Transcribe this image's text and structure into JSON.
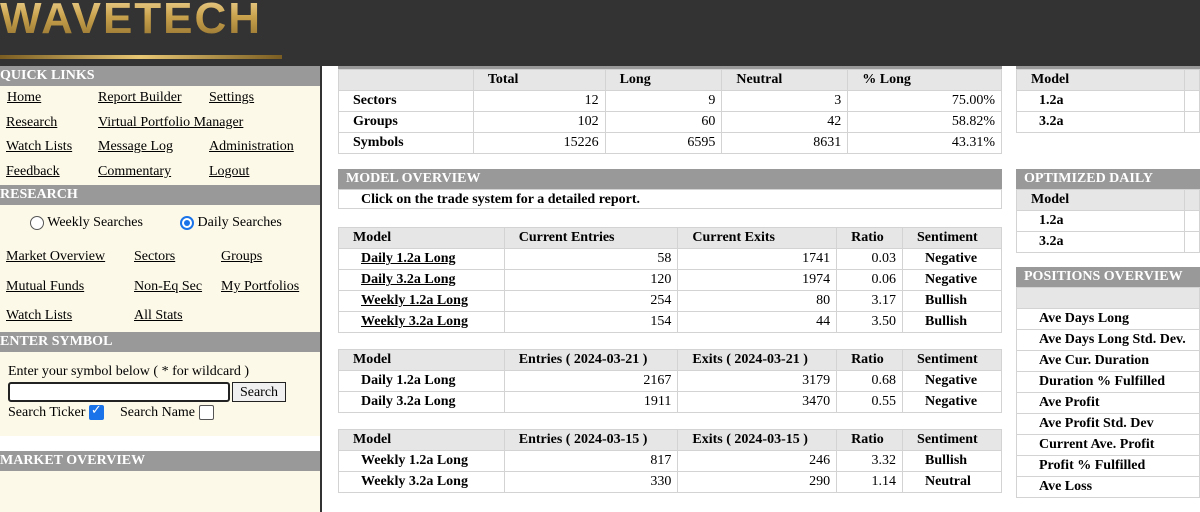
{
  "brand": {
    "name": "WAVETECH"
  },
  "quick_links": {
    "title": "QUICK LINKS",
    "links": [
      "Home",
      "Report Builder",
      "Settings",
      "Research",
      "Virtual Portfolio Manager",
      "Watch Lists",
      "Message Log",
      "Administration",
      "Feedback",
      "Commentary",
      "Logout"
    ]
  },
  "research": {
    "title": "RESEARCH",
    "radio_weekly": "Weekly Searches",
    "radio_daily": "Daily Searches",
    "links": [
      "Market Overview",
      "Sectors",
      "Groups",
      "Mutual Funds",
      "Non-Eq Sec",
      "My Portfolios",
      "Watch Lists",
      "All Stats"
    ]
  },
  "enter_symbol": {
    "title": "ENTER SYMBOL",
    "prompt": "Enter your symbol below ( * for wildcard )",
    "input_value": "",
    "search_button": "Search",
    "search_ticker": "Search Ticker",
    "search_name": "Search Name",
    "search_ticker_checked": true,
    "search_name_checked": false
  },
  "market_overview_side": {
    "title": "MARKET OVERVIEW"
  },
  "summary_table": {
    "headers": [
      "",
      "Total",
      "Long",
      "Neutral",
      "% Long"
    ],
    "rows": [
      [
        "Sectors",
        "12",
        "9",
        "3",
        "75.00%"
      ],
      [
        "Groups",
        "102",
        "60",
        "42",
        "58.82%"
      ],
      [
        "Symbols",
        "15226",
        "6595",
        "8631",
        "43.31%"
      ]
    ]
  },
  "model_overview": {
    "title": "MODEL OVERVIEW",
    "note": "Click on the trade system for a detailed report.",
    "table1": {
      "headers": [
        "Model",
        "Current Entries",
        "Current Exits",
        "Ratio",
        "Sentiment"
      ],
      "rows": [
        [
          "Daily 1.2a Long",
          "58",
          "1741",
          "0.03",
          "Negative"
        ],
        [
          "Daily 3.2a Long",
          "120",
          "1974",
          "0.06",
          "Negative"
        ],
        [
          "Weekly 1.2a Long",
          "254",
          "80",
          "3.17",
          "Bullish"
        ],
        [
          "Weekly 3.2a Long",
          "154",
          "44",
          "3.50",
          "Bullish"
        ]
      ]
    },
    "table2": {
      "headers": [
        "Model",
        "Entries ( 2024-03-21 )",
        "Exits ( 2024-03-21 )",
        "Ratio",
        "Sentiment"
      ],
      "rows": [
        [
          "Daily 1.2a Long",
          "2167",
          "3179",
          "0.68",
          "Negative"
        ],
        [
          "Daily 3.2a Long",
          "1911",
          "3470",
          "0.55",
          "Negative"
        ]
      ]
    },
    "table3": {
      "headers": [
        "Model",
        "Entries ( 2024-03-15 )",
        "Exits ( 2024-03-15 )",
        "Ratio",
        "Sentiment"
      ],
      "rows": [
        [
          "Weekly 1.2a Long",
          "817",
          "246",
          "3.32",
          "Bullish"
        ],
        [
          "Weekly 3.2a Long",
          "330",
          "290",
          "1.14",
          "Neutral"
        ]
      ]
    }
  },
  "right_model_table": {
    "header": "Model",
    "rows": [
      "1.2a",
      "3.2a"
    ]
  },
  "optimized_daily": {
    "title": "OPTIMIZED DAILY",
    "header": "Model",
    "rows": [
      "1.2a",
      "3.2a"
    ]
  },
  "positions_overview": {
    "title": "POSITIONS OVERVIEW",
    "rows": [
      "Ave Days Long",
      "Ave Days Long Std. Dev.",
      "Ave Cur. Duration",
      "Duration % Fulfilled",
      "Ave Profit",
      "Ave Profit Std. Dev",
      "Current Ave. Profit",
      "Profit % Fulfilled",
      "Ave Loss"
    ]
  }
}
